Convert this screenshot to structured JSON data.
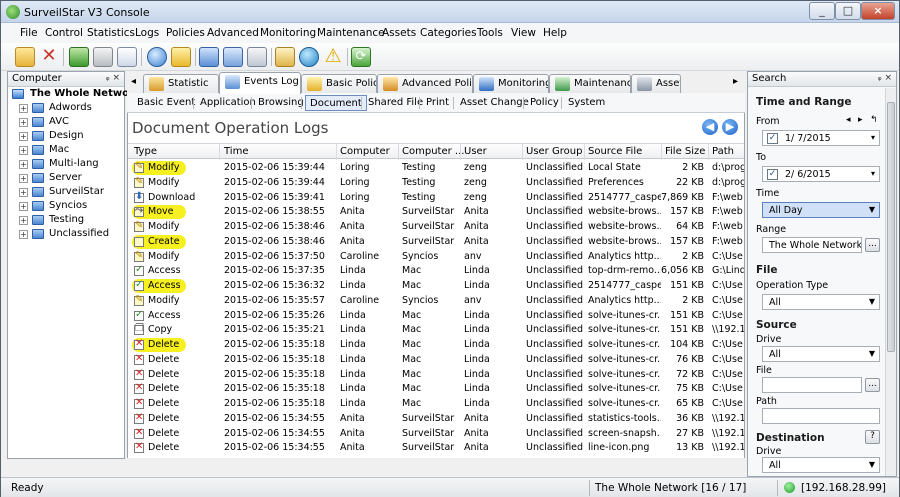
{
  "window": {
    "title": "SurveilStar V3 Console",
    "controls": [
      "_",
      "□",
      "×"
    ]
  },
  "menu": [
    "File",
    "Control",
    "Statistics",
    "Logs",
    "Policies",
    "Advanced",
    "Monitoring",
    "Maintenance",
    "Assets",
    "Categories",
    "Tools",
    "View",
    "Help"
  ],
  "toolbar_icons": [
    "open-folder-icon",
    "delete-icon",
    "login-icon",
    "print-icon",
    "print-preview-icon",
    "globe-icon",
    "tag-icon",
    "computers-icon",
    "find-computer-icon",
    "edit-policy-icon",
    "report-icon",
    "network-icon",
    "alert-icon",
    "refresh-icon"
  ],
  "computer_panel": {
    "title": "Computer",
    "pin": "ᵩ ×",
    "root": "The Whole Network",
    "groups": [
      "Adwords",
      "AVC",
      "Design",
      "Mac",
      "Multi-lang",
      "Server",
      "SurveilStar",
      "Syncios",
      "Testing",
      "Unclassified"
    ]
  },
  "tabs": [
    "Statistic",
    "Events Log",
    "Basic Policy",
    "Advanced Policy",
    "Monitoring",
    "Maintenance",
    "Asset"
  ],
  "tab_scroll": {
    "left": "◂",
    "right": "▸"
  },
  "subtabs": [
    "Basic Event",
    "Application",
    "Browsing",
    "Document",
    "Shared File",
    "Print",
    "Asset Change",
    "Policy",
    "System"
  ],
  "main": {
    "title": "Document Operation Logs",
    "nav_back": "◀",
    "nav_forward": "▶",
    "columns": [
      "Type",
      "Time",
      "Computer",
      "Computer ...",
      "User",
      "User Group",
      "Source File",
      "File Size",
      "Path"
    ],
    "rows": [
      {
        "type": "Modify",
        "icon": "modify",
        "hl": true,
        "time": "2015-02-06 15:39:44",
        "computer": "Loring",
        "group": "Testing",
        "user": "zeng",
        "ugroup": "Unclassified",
        "file": "Local State",
        "size": "2 KB",
        "path": "d:\\prog"
      },
      {
        "type": "Modify",
        "icon": "modify",
        "hl": false,
        "time": "2015-02-06 15:39:44",
        "computer": "Loring",
        "group": "Testing",
        "user": "zeng",
        "ugroup": "Unclassified",
        "file": "Preferences",
        "size": "22 KB",
        "path": "d:\\prog"
      },
      {
        "type": "Download",
        "icon": "download",
        "hl": false,
        "time": "2015-02-06 15:39:41",
        "computer": "Loring",
        "group": "Testing",
        "user": "zeng",
        "ugroup": "Unclassified",
        "file": "2514777_caspe...",
        "size": "7,869 KB",
        "path": "F:\\web"
      },
      {
        "type": "Move",
        "icon": "move",
        "hl": true,
        "time": "2015-02-06 15:38:55",
        "computer": "Anita",
        "group": "SurveilStar",
        "user": "Anita",
        "ugroup": "Unclassified",
        "file": "website-brows...",
        "size": "157 KB",
        "path": "F:\\web"
      },
      {
        "type": "Modify",
        "icon": "modify",
        "hl": false,
        "time": "2015-02-06 15:38:46",
        "computer": "Anita",
        "group": "SurveilStar",
        "user": "Anita",
        "ugroup": "Unclassified",
        "file": "website-brows...",
        "size": "64 KB",
        "path": "F:\\web"
      },
      {
        "type": "Create",
        "icon": "create",
        "hl": true,
        "time": "2015-02-06 15:38:46",
        "computer": "Anita",
        "group": "SurveilStar",
        "user": "Anita",
        "ugroup": "Unclassified",
        "file": "website-brows...",
        "size": "157 KB",
        "path": "F:\\web"
      },
      {
        "type": "Modify",
        "icon": "modify",
        "hl": false,
        "time": "2015-02-06 15:37:50",
        "computer": "Caroline",
        "group": "Syncios",
        "user": "anv",
        "ugroup": "Unclassified",
        "file": "Analytics http...",
        "size": "2 KB",
        "path": "C:\\Use"
      },
      {
        "type": "Access",
        "icon": "access",
        "hl": false,
        "time": "2015-02-06 15:37:35",
        "computer": "Linda",
        "group": "Mac",
        "user": "Linda",
        "ugroup": "Unclassified",
        "file": "top-drm-remo...",
        "size": "6,056 KB",
        "path": "G:\\Lind"
      },
      {
        "type": "Access",
        "icon": "access",
        "hl": true,
        "time": "2015-02-06 15:36:32",
        "computer": "Linda",
        "group": "Mac",
        "user": "Linda",
        "ugroup": "Unclassified",
        "file": "2514777_caspe...",
        "size": "151 KB",
        "path": "C:\\Use"
      },
      {
        "type": "Modify",
        "icon": "modify",
        "hl": false,
        "time": "2015-02-06 15:35:57",
        "computer": "Caroline",
        "group": "Syncios",
        "user": "anv",
        "ugroup": "Unclassified",
        "file": "Analytics http...",
        "size": "2 KB",
        "path": "C:\\Use"
      },
      {
        "type": "Access",
        "icon": "access",
        "hl": false,
        "time": "2015-02-06 15:35:26",
        "computer": "Linda",
        "group": "Mac",
        "user": "Linda",
        "ugroup": "Unclassified",
        "file": "solve-itunes-cr...",
        "size": "151 KB",
        "path": "C:\\Use"
      },
      {
        "type": "Copy",
        "icon": "copy",
        "hl": false,
        "time": "2015-02-06 15:35:21",
        "computer": "Linda",
        "group": "Mac",
        "user": "Linda",
        "ugroup": "Unclassified",
        "file": "solve-itunes-cr...",
        "size": "151 KB",
        "path": "\\\\192.1"
      },
      {
        "type": "Delete",
        "icon": "delete",
        "hl": true,
        "time": "2015-02-06 15:35:18",
        "computer": "Linda",
        "group": "Mac",
        "user": "Linda",
        "ugroup": "Unclassified",
        "file": "solve-itunes-cr...",
        "size": "104 KB",
        "path": "C:\\Use"
      },
      {
        "type": "Delete",
        "icon": "delete",
        "hl": false,
        "time": "2015-02-06 15:35:18",
        "computer": "Linda",
        "group": "Mac",
        "user": "Linda",
        "ugroup": "Unclassified",
        "file": "solve-itunes-cr...",
        "size": "76 KB",
        "path": "C:\\Use"
      },
      {
        "type": "Delete",
        "icon": "delete",
        "hl": false,
        "time": "2015-02-06 15:35:18",
        "computer": "Linda",
        "group": "Mac",
        "user": "Linda",
        "ugroup": "Unclassified",
        "file": "solve-itunes-cr...",
        "size": "72 KB",
        "path": "C:\\Use"
      },
      {
        "type": "Delete",
        "icon": "delete",
        "hl": false,
        "time": "2015-02-06 15:35:18",
        "computer": "Linda",
        "group": "Mac",
        "user": "Linda",
        "ugroup": "Unclassified",
        "file": "solve-itunes-cr...",
        "size": "75 KB",
        "path": "C:\\Use"
      },
      {
        "type": "Delete",
        "icon": "delete",
        "hl": false,
        "time": "2015-02-06 15:35:18",
        "computer": "Linda",
        "group": "Mac",
        "user": "Linda",
        "ugroup": "Unclassified",
        "file": "solve-itunes-cr...",
        "size": "65 KB",
        "path": "C:\\Use"
      },
      {
        "type": "Delete",
        "icon": "delete",
        "hl": false,
        "time": "2015-02-06 15:34:55",
        "computer": "Anita",
        "group": "SurveilStar",
        "user": "Anita",
        "ugroup": "Unclassified",
        "file": "statistics-tools...",
        "size": "36 KB",
        "path": "\\\\192.1"
      },
      {
        "type": "Delete",
        "icon": "delete",
        "hl": false,
        "time": "2015-02-06 15:34:55",
        "computer": "Anita",
        "group": "SurveilStar",
        "user": "Anita",
        "ugroup": "Unclassified",
        "file": "screen-snapsh...",
        "size": "27 KB",
        "path": "\\\\192.1"
      },
      {
        "type": "Delete",
        "icon": "delete",
        "hl": false,
        "time": "2015-02-06 15:34:55",
        "computer": "Anita",
        "group": "SurveilStar",
        "user": "Anita",
        "ugroup": "Unclassified",
        "file": "line-icon.png",
        "size": "13 KB",
        "path": "\\\\192.1"
      }
    ]
  },
  "search_panel": {
    "title": "Search",
    "pin": "ᵩ ×",
    "time_and_range": "Time and Range",
    "from_label": "From",
    "from_value": "1/  7/2015",
    "to_label": "To",
    "to_value": "2/  6/2015",
    "time_label": "Time",
    "time_value": "All Day",
    "range_label": "Range",
    "range_value": "The Whole Network",
    "browse": "...",
    "file_section": "File",
    "op_type_label": "Operation Type",
    "op_type_value": "All",
    "source_section": "Source",
    "drive_label": "Drive",
    "drive_value": "All",
    "file_label": "File",
    "path_label": "Path",
    "destination_section": "Destination",
    "help": "?",
    "dest_drive_label": "Drive",
    "dest_drive_value": "All",
    "arrows": [
      "◂",
      "▸",
      "↰"
    ]
  },
  "status": {
    "left": "Ready",
    "network": "The Whole Network [16 / 17]",
    "ip": "[192.168.28.99]"
  },
  "colors": {
    "highlight": "#f7f021",
    "accent": "#1e63c7",
    "delete_red": "#d22020",
    "access_green": "#2a9a2a"
  }
}
